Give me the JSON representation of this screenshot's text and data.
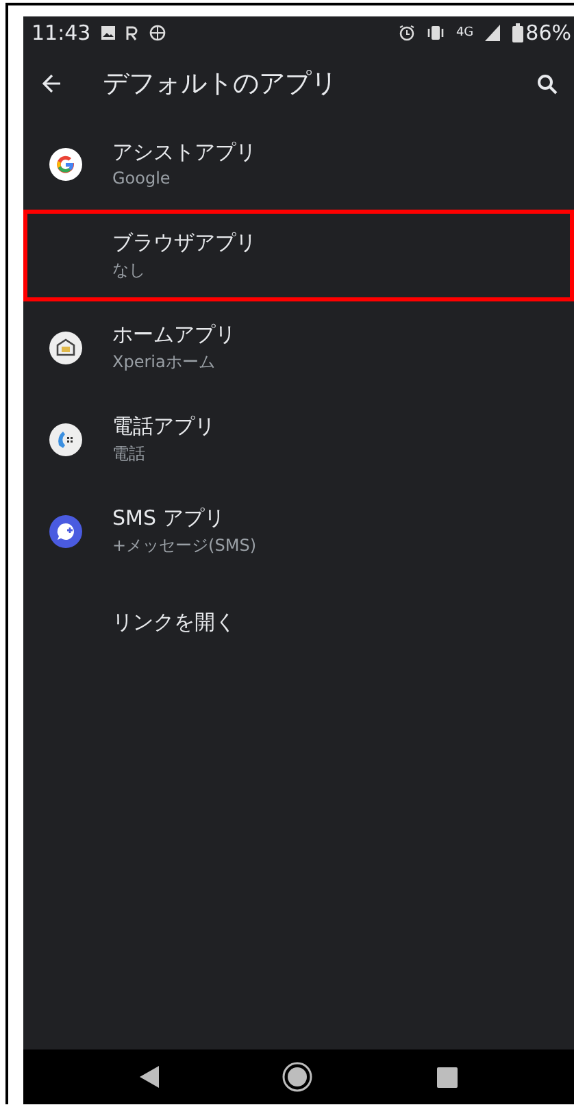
{
  "status_bar": {
    "time": "11:43",
    "network": "4G",
    "battery": "86%"
  },
  "toolbar": {
    "title": "デフォルトのアプリ"
  },
  "items": [
    {
      "kind": "google",
      "title": "アシストアプリ",
      "summary": "Google",
      "highlighted": false
    },
    {
      "kind": "none",
      "title": "ブラウザアプリ",
      "summary": "なし",
      "highlighted": true
    },
    {
      "kind": "home",
      "title": "ホームアプリ",
      "summary": "Xperiaホーム",
      "highlighted": false
    },
    {
      "kind": "phone",
      "title": "電話アプリ",
      "summary": "電話",
      "highlighted": false
    },
    {
      "kind": "message",
      "title": "SMS アプリ",
      "summary": "+メッセージ(SMS)",
      "highlighted": false
    },
    {
      "kind": "none",
      "title": "リンクを開く",
      "highlighted": false
    }
  ]
}
